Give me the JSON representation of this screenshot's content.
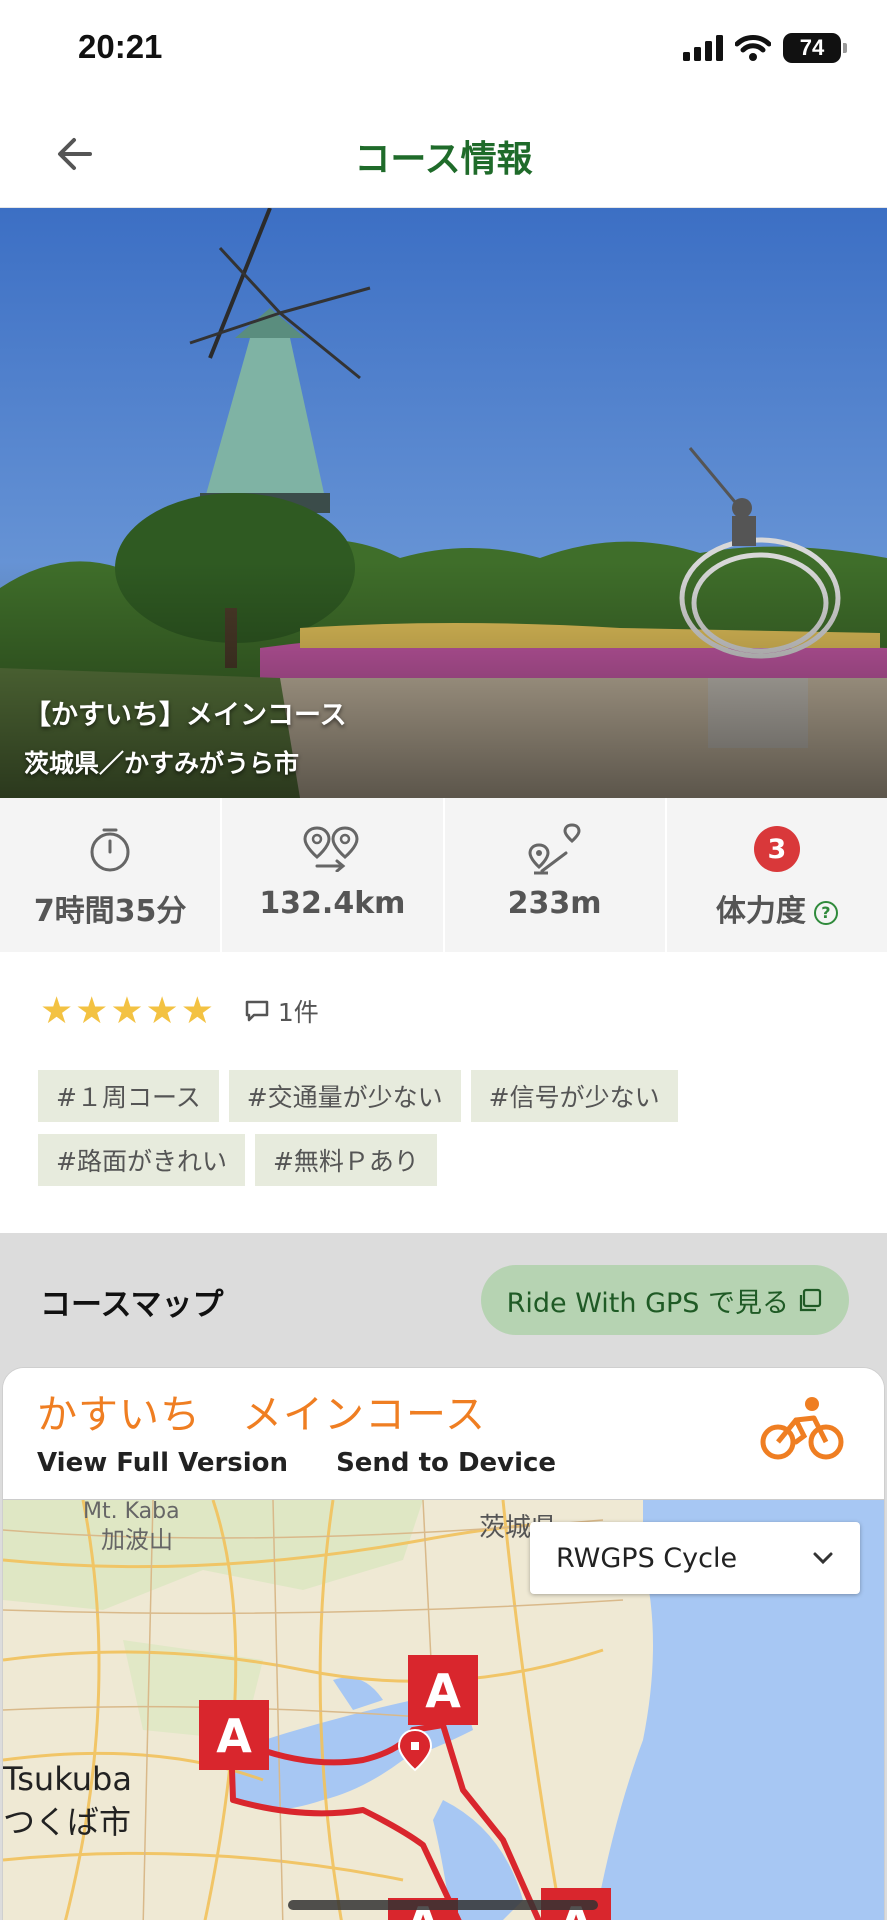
{
  "status": {
    "time": "20:21",
    "battery": "74"
  },
  "header": {
    "title": "コース情報"
  },
  "hero": {
    "course_name": "【かすいち】メインコース",
    "location": "茨城県／かすみがうら市"
  },
  "stats": {
    "time": "7時間35分",
    "distance": "132.4km",
    "elevation": "233m",
    "level": "3",
    "level_label": "体力度"
  },
  "rating": {
    "stars": 5,
    "comment_count": "1件"
  },
  "tags": [
    "#１周コース",
    "#交通量が少ない",
    "#信号が少ない",
    "#路面がきれい",
    "#無料Ｐあり"
  ],
  "course_map": {
    "heading": "コースマップ",
    "gps_button": "Ride With GPS で見る",
    "embed_title": "かすいち　メインコース",
    "view_full": "View Full Version",
    "send_device": "Send to Device",
    "map_type": "RWGPS Cycle",
    "map_labels": {
      "mt_kaba_en": "Mt. Kaba",
      "mt_kaba_jp": "加波山",
      "pref": "茨城県",
      "tsukuba_en": "Tsukuba",
      "tsukuba_jp": "つくば市"
    },
    "marker_label": "A"
  },
  "colors": {
    "accent_green": "#1f6b2a",
    "orange": "#ef7e22",
    "route_red": "#d9262d",
    "star": "#f3c242"
  }
}
